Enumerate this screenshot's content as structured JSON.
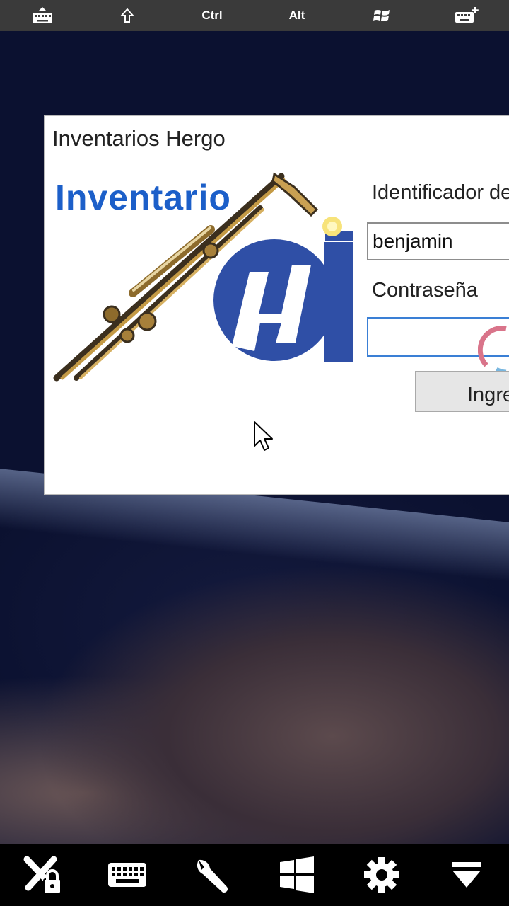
{
  "top_toolbar": {
    "items": [
      {
        "icon": "keyboard-hide-icon"
      },
      {
        "icon": "shift-arrow-icon"
      },
      {
        "label": "Ctrl"
      },
      {
        "label": "Alt"
      },
      {
        "icon": "windows-logo-icon"
      },
      {
        "icon": "keyboard-add-icon"
      }
    ]
  },
  "dialog": {
    "title": "Inventarios Hergo",
    "logo_text": "Inventario",
    "username_label": "Identificador de",
    "username_value": "benjamin",
    "password_label": "Contraseña",
    "password_value": "",
    "login_button": "Ingre"
  },
  "bottom_toolbar": {
    "items": [
      {
        "icon": "disconnect-lock-icon"
      },
      {
        "icon": "keyboard-icon"
      },
      {
        "icon": "wrench-icon"
      },
      {
        "icon": "windows-icon"
      },
      {
        "icon": "gear-icon"
      },
      {
        "icon": "collapse-icon"
      }
    ]
  },
  "colors": {
    "logo_blue": "#1c5fc9",
    "toolbar_top": "#3a3a3a",
    "toolbar_bottom": "#000000",
    "focus_blue": "#3a7fd5"
  }
}
